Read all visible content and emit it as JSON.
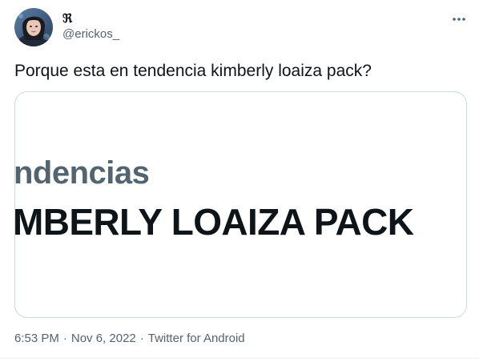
{
  "user": {
    "display_name": "ℜ",
    "handle": "@erickos_",
    "avatar_icon": "profile-avatar"
  },
  "tweet": {
    "text": "Porque esta en tendencia kimberly loaiza pack?"
  },
  "media": {
    "line1": "ndencias",
    "line2": "MBERLY LOAIZA PACK"
  },
  "meta": {
    "time": "6:53 PM",
    "separator1": "·",
    "date": "Nov 6, 2022",
    "separator2": "·",
    "source": "Twitter for Android"
  },
  "icons": {
    "more": "more-horizontal-icon"
  },
  "colors": {
    "primary_text": "#0f1419",
    "secondary_text": "#536471",
    "border": "#cfd9de"
  }
}
